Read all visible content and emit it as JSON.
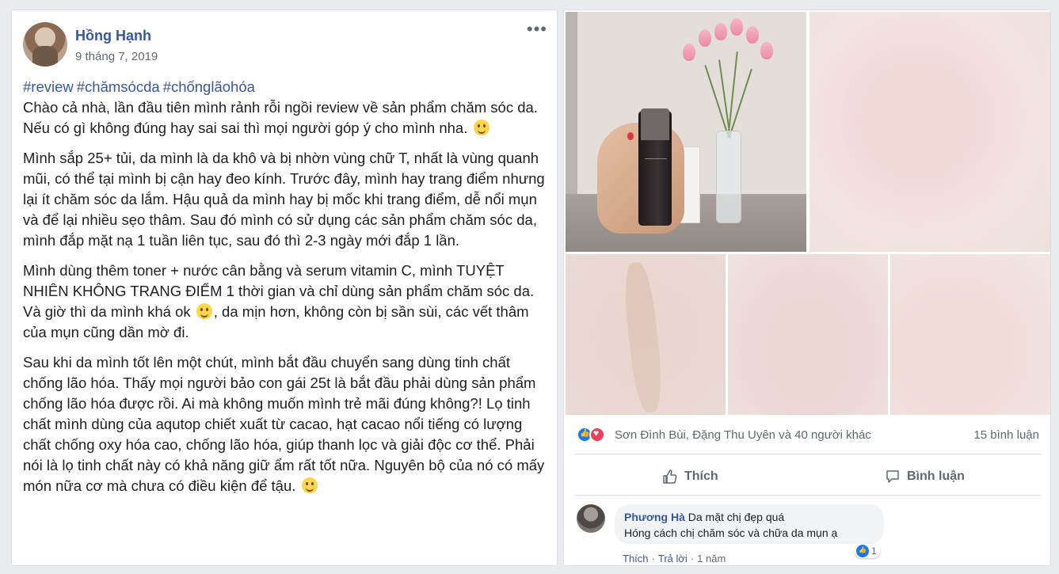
{
  "post": {
    "author": "Hồng Hạnh",
    "date": "9 tháng 7, 2019",
    "more_icon": "•••",
    "hashtags": [
      "#review",
      "#chămsócda",
      "#chốnglãohóa"
    ],
    "para1": "Chào cả nhà, lần đầu tiên mình rảnh rỗi ngồi review về sản phẩm chăm sóc da. Nếu có gì không đúng hay sai sai thì mọi người góp ý cho mình nha.",
    "para2": "Mình sắp 25+ tủi, da mình là da khô và bị nhờn vùng chữ T, nhất là vùng quanh mũi, có thể tại mình bị cận hay đeo kính. Trước đây, mình hay trang điểm nhưng lại ít chăm sóc da lắm. Hậu quả da mình hay bị mốc khi trang điểm, dễ nổi mụn và để lại nhiều sẹo thâm. Sau đó mình có sử dụng các sản phẩm chăm sóc da, mình đắp mặt nạ 1 tuần liên tục, sau đó thì 2-3 ngày mới đắp 1 lần.",
    "para3a": "Mình dùng thêm toner + nước cân bằng và serum vitamin C, mình TUYỆT NHIÊN KHÔNG TRANG ĐIỂM 1 thời gian và chỉ dùng sản phẩm chăm sóc da. Và giờ thì da mình khá ok",
    "para3b": ", da mịn hơn, không còn bị sần sùi, các vết thâm của mụn cũng dần mờ đi.",
    "para4": "Sau khi da mình tốt lên một chút, mình bắt đầu chuyển sang dùng tinh chất chống lão hóa. Thấy mọi người bảo con gái 25t là bắt đầu phải dùng sản phẩm chống lão hóa được rồi. Ai mà không muốn mình trẻ mãi đúng không?! Lọ tinh chất mình dùng của aqutop chiết xuất từ cacao, hạt cacao nổi tiếng có lượng chất chống oxy hóa cao, chống lão hóa, giúp thanh lọc và giải độc cơ thể. Phải nói là lọ tinh chất này có khả năng giữ ẩm rất tốt nữa. Nguyên bộ của nó có mấy món nữa cơ mà chưa có điều kiện để tậu."
  },
  "media": {
    "reactions_text": "Sơn Đình Bùi, Đặng Thu Uyên và 40 người khác",
    "comments_count": "15 bình luận",
    "like_label": "Thích",
    "comment_label": "Bình luận",
    "reaction_icons": [
      "like-icon",
      "love-icon"
    ]
  },
  "comment": {
    "name": "Phương Hà",
    "text_line1": "Da mặt chị đẹp quá",
    "text_line2": "Hóng cách chị chăm sóc và chữa da mụn ạ",
    "like_count": "1",
    "action_like": "Thích",
    "action_reply": "Trả lời",
    "time": "1 năm"
  },
  "colors": {
    "link": "#385898",
    "background": "#e9ebee",
    "like_blue": "#1877f2",
    "love_red": "#f33e58"
  }
}
